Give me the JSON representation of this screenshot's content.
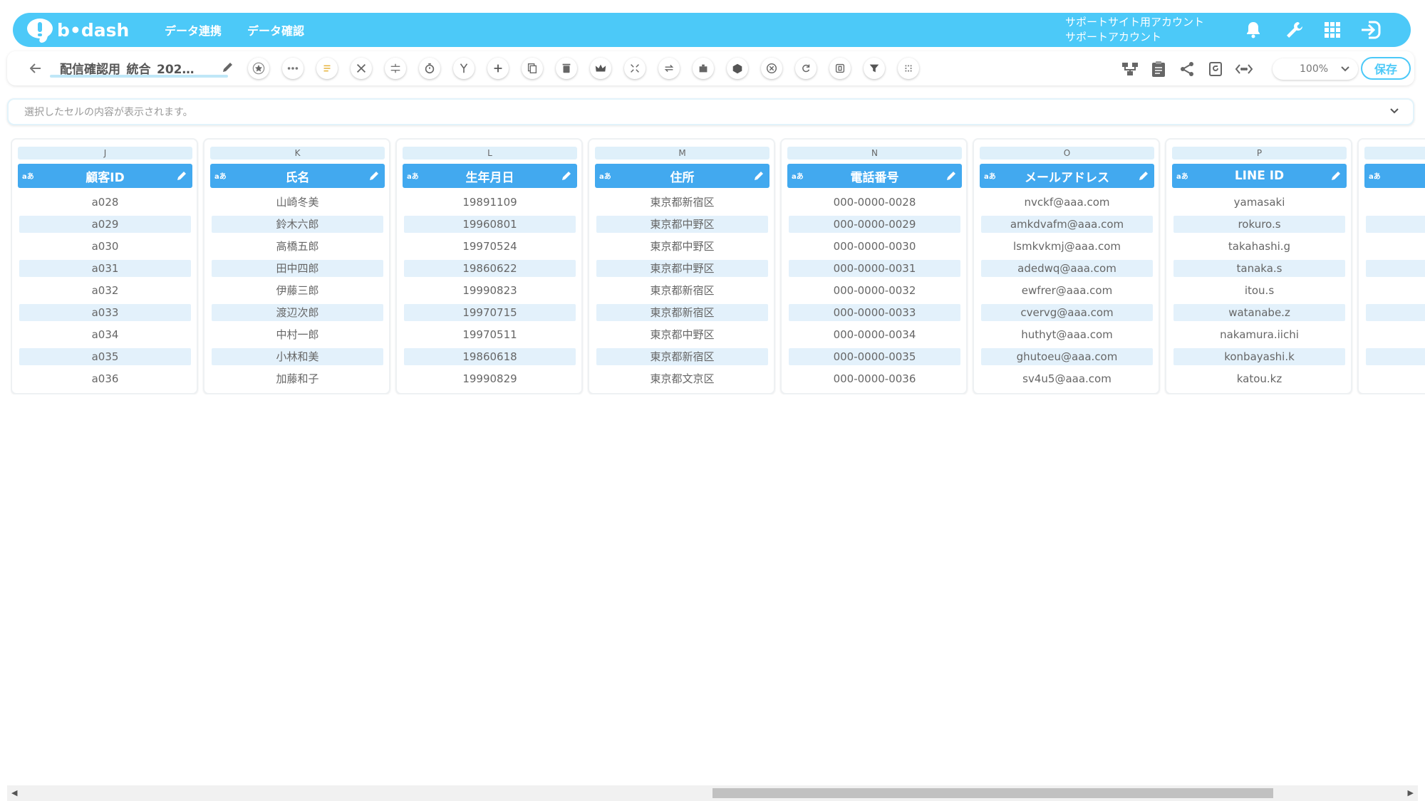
{
  "header": {
    "logo_text": "b•dash",
    "nav": [
      "データ連携",
      "データ確認"
    ],
    "account_line1": "サポートサイト用アカウント",
    "account_line2": "サポートアカウント",
    "icons": [
      "bell-icon",
      "wrench-icon",
      "apps-grid-icon",
      "logout-icon"
    ]
  },
  "toolbar": {
    "back_icon": "arrow-left-icon",
    "title": "配信確認用_統合_202…",
    "tools": [
      "star-icon",
      "more-icon",
      "list-icon",
      "tools-icon",
      "split-icon",
      "timer-icon",
      "merge-icon",
      "plus-icon",
      "copy-icon",
      "trash-icon",
      "crown-icon",
      "expand-icon",
      "repeat-icon",
      "building-icon",
      "package-icon",
      "cancel-icon",
      "refresh-icon",
      "frame-icon",
      "filter-icon",
      "pattern-icon"
    ],
    "right_icons": [
      "flow-icon",
      "clipboard-icon",
      "share-icon",
      "history-icon",
      "code-icon"
    ],
    "zoom": "100%",
    "save": "保存"
  },
  "cellbar": {
    "placeholder": "選択したセルの内容が表示されます。"
  },
  "columns": [
    {
      "letter": "J",
      "name": "顧客ID",
      "type": "aあ",
      "cells": [
        "a028",
        "a029",
        "a030",
        "a031",
        "a032",
        "a033",
        "a034",
        "a035",
        "a036"
      ]
    },
    {
      "letter": "K",
      "name": "氏名",
      "type": "aあ",
      "cells": [
        "山崎冬美",
        "鈴木六郎",
        "高橋五郎",
        "田中四郎",
        "伊藤三郎",
        "渡辺次郎",
        "中村一郎",
        "小林和美",
        "加藤和子"
      ]
    },
    {
      "letter": "L",
      "name": "生年月日",
      "type": "aあ",
      "cells": [
        "19891109",
        "19960801",
        "19970524",
        "19860622",
        "19990823",
        "19970715",
        "19970511",
        "19860618",
        "19990829"
      ]
    },
    {
      "letter": "M",
      "name": "住所",
      "type": "aあ",
      "cells": [
        "東京都新宿区",
        "東京都中野区",
        "東京都中野区",
        "東京都中野区",
        "東京都新宿区",
        "東京都新宿区",
        "東京都中野区",
        "東京都新宿区",
        "東京都文京区"
      ]
    },
    {
      "letter": "N",
      "name": "電話番号",
      "type": "aあ",
      "cells": [
        "000-0000-0028",
        "000-0000-0029",
        "000-0000-0030",
        "000-0000-0031",
        "000-0000-0032",
        "000-0000-0033",
        "000-0000-0034",
        "000-0000-0035",
        "000-0000-0036"
      ]
    },
    {
      "letter": "O",
      "name": "メールアドレス",
      "type": "aあ",
      "cells": [
        "nvckf@aaa.com",
        "amkdvafm@aaa.com",
        "lsmkvkmj@aaa.com",
        "adedwq@aaa.com",
        "ewfrer@aaa.com",
        "cvervg@aaa.com",
        "huthyt@aaa.com",
        "ghutoeu@aaa.com",
        "sv4u5@aaa.com"
      ]
    },
    {
      "letter": "P",
      "name": "LINE ID",
      "type": "aあ",
      "cells": [
        "yamasaki",
        "rokuro.s",
        "takahashi.g",
        "tanaka.s",
        "itou.s",
        "watanabe.z",
        "nakamura.iichi",
        "konbayashi.k",
        "katou.kz"
      ]
    },
    {
      "letter": "",
      "name": "",
      "type": "aあ",
      "cells": [
        "",
        "",
        "",
        "",
        "",
        "",
        "",
        "",
        ""
      ]
    }
  ]
}
